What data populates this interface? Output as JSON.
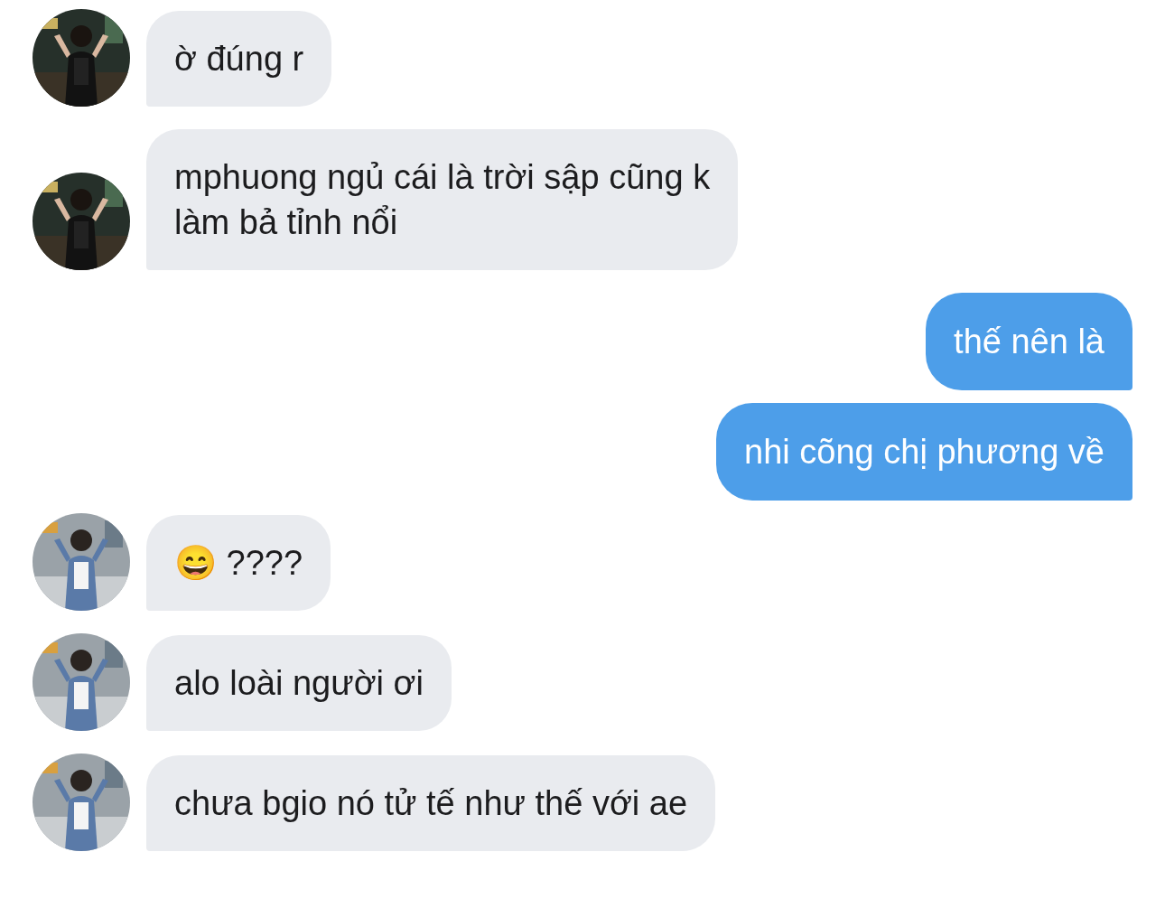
{
  "messages": [
    {
      "kind": "incoming",
      "text": "ờ đúng r"
    },
    {
      "kind": "incoming",
      "text": "mphuong ngủ cái là trời sập cũng k\nlàm bả tỉnh nổi"
    },
    {
      "kind": "outgoing",
      "text": "thế nên là"
    },
    {
      "kind": "outgoing",
      "text": "nhi cõng chị phương về"
    },
    {
      "kind": "incoming",
      "text": "😄 ????"
    },
    {
      "kind": "incoming",
      "text": "alo loài người ơi"
    },
    {
      "kind": "incoming",
      "text": "chưa bgio nó tử tế như thế với ae"
    }
  ]
}
